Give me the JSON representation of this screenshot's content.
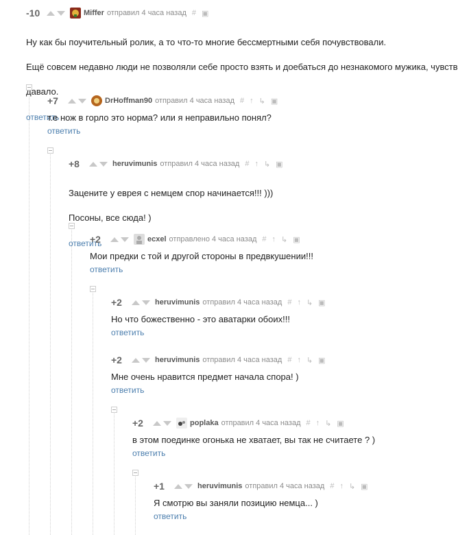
{
  "reply_label": "ответить",
  "comments": [
    {
      "rating": "-10",
      "author": "Miffer",
      "meta": "отправил 4 часа назад",
      "lines": [
        "Ну как бы поучительный ролик, а то что-то многие бессмертными себя почувствовали.",
        "Ещё совсем недавно люди не позволяли себе просто взять и доебаться до незнакомого мужика, чувство",
        "давало."
      ]
    },
    {
      "rating": "+7",
      "author": "DrHoffman90",
      "meta": "отправил 4 часа назад",
      "lines": [
        "т.е нож в горло это норма? или я неправильно понял?"
      ]
    },
    {
      "rating": "+8",
      "author": "heruvimunis",
      "meta": "отправил 4 часа назад",
      "lines": [
        "Зацените у еврея с немцем спор начинается!!! )))",
        "Посоны, все сюда! )"
      ]
    },
    {
      "rating": "+2",
      "author": "ecxel",
      "meta": "отправлено 4 часа назад",
      "lines": [
        "Мои предки с той и другой стороны в предвкушении!!!"
      ]
    },
    {
      "rating": "+2",
      "author": "heruvimunis",
      "meta": "отправил 4 часа назад",
      "lines": [
        "Но что божественно - это аватарки обоих!!!"
      ]
    },
    {
      "rating": "+2",
      "author": "heruvimunis",
      "meta": "отправил 4 часа назад",
      "lines": [
        "Мне очень нравится предмет начала спора! )"
      ]
    },
    {
      "rating": "+2",
      "author": "poplaka",
      "meta": "отправил 4 часа назад",
      "lines": [
        "в этом поединке огонька не хватает, вы так не считаете ? )"
      ]
    },
    {
      "rating": "+1",
      "author": "heruvimunis",
      "meta": "отправил 4 часа назад",
      "lines": [
        "Я смотрю вы заняли позицию немца... )"
      ]
    }
  ]
}
